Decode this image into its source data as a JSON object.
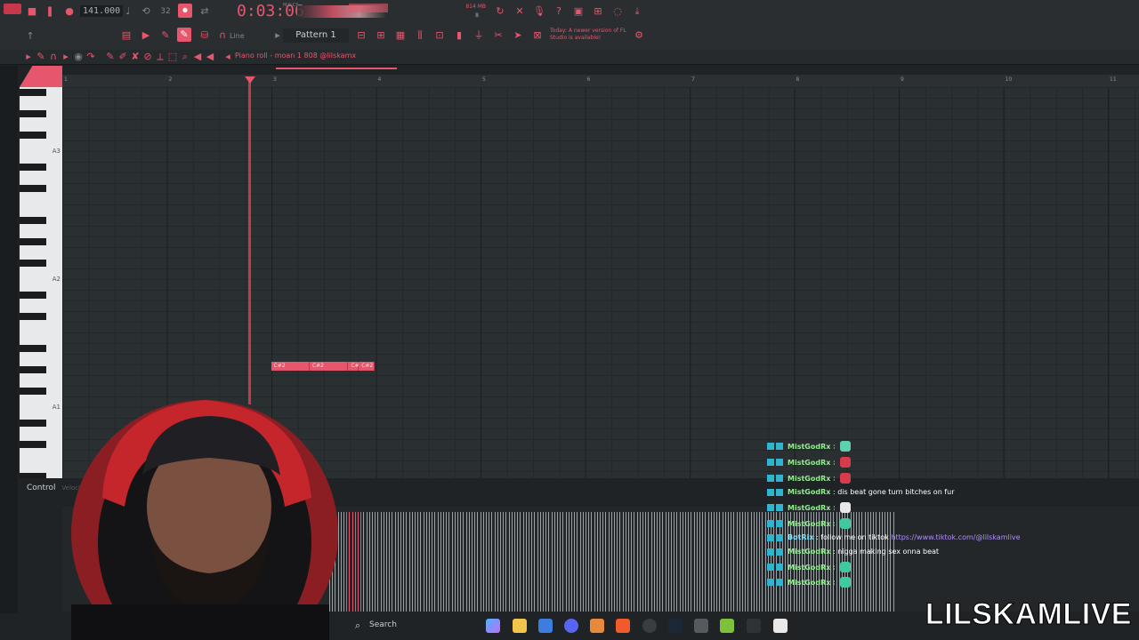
{
  "toolbar": {
    "tempo": "141.000",
    "time": "0:03:06",
    "time_unit": "M:S:CS",
    "pattern": "Pattern 1",
    "snap": "Line",
    "news": "Today: A newer version of FL Studio is available!",
    "memory": "814 MB",
    "counter": "8"
  },
  "piano_roll": {
    "title": "Piano roll - moan 1 808 @lilskamx",
    "ruler": [
      "1",
      "2",
      "3",
      "4",
      "5",
      "6",
      "7",
      "8",
      "9",
      "10",
      "11"
    ],
    "key_labels": [
      "A3",
      "A2",
      "A1"
    ],
    "notes": [
      {
        "label": "C#2",
        "start": 2.2,
        "length": 0.37
      },
      {
        "label": "C#2",
        "start": 2.57,
        "length": 0.37
      },
      {
        "label": "C#2",
        "start": 2.94,
        "length": 0.1
      },
      {
        "label": "C#2",
        "start": 3.04,
        "length": 0.15
      }
    ],
    "playhead_bar": 1.98,
    "control_label": "Control",
    "control_sub": "Velocity"
  },
  "chat": [
    {
      "user": "MistGodRx",
      "sep": " :",
      "msg": "",
      "emote": "#5fd0b0"
    },
    {
      "user": "MistGodRx",
      "sep": " :",
      "msg": "",
      "emote": "#d83b4c"
    },
    {
      "user": "MistGodRx",
      "sep": " :",
      "msg": "",
      "emote": "#d83b4c"
    },
    {
      "user": "MistGodRx",
      "sep": " :",
      "msg": "dis beat gone turn bitches on fur",
      "emote": ""
    },
    {
      "user": "MistGodRx",
      "sep": " :",
      "msg": "",
      "emote": "#e8e8e8"
    },
    {
      "user": "MistGodRx",
      "sep": " :",
      "msg": "",
      "emote": "#3ec9a0"
    },
    {
      "user": "BotRix",
      "sep": " :",
      "msg": "follow me on tiktok",
      "link": "https://www.tiktok.com/@lilskamlive",
      "emote": ""
    },
    {
      "user": "MistGodRx",
      "sep": " :",
      "msg": "nigga making sex onna beat",
      "emote": ""
    },
    {
      "user": "MistGodRx",
      "sep": " :",
      "msg": "",
      "emote": "#3ec9a0"
    },
    {
      "user": "MistGodRx",
      "sep": " :",
      "msg": "",
      "emote": "#3ec9a0"
    }
  ],
  "taskbar": {
    "search_placeholder": "Search"
  },
  "overlay": {
    "watermark": "LILSKAMLIVE"
  },
  "colors": {
    "accent": "#e6566c",
    "chat_user": "#8df08a",
    "chat_bot": "#7fe6ff"
  }
}
